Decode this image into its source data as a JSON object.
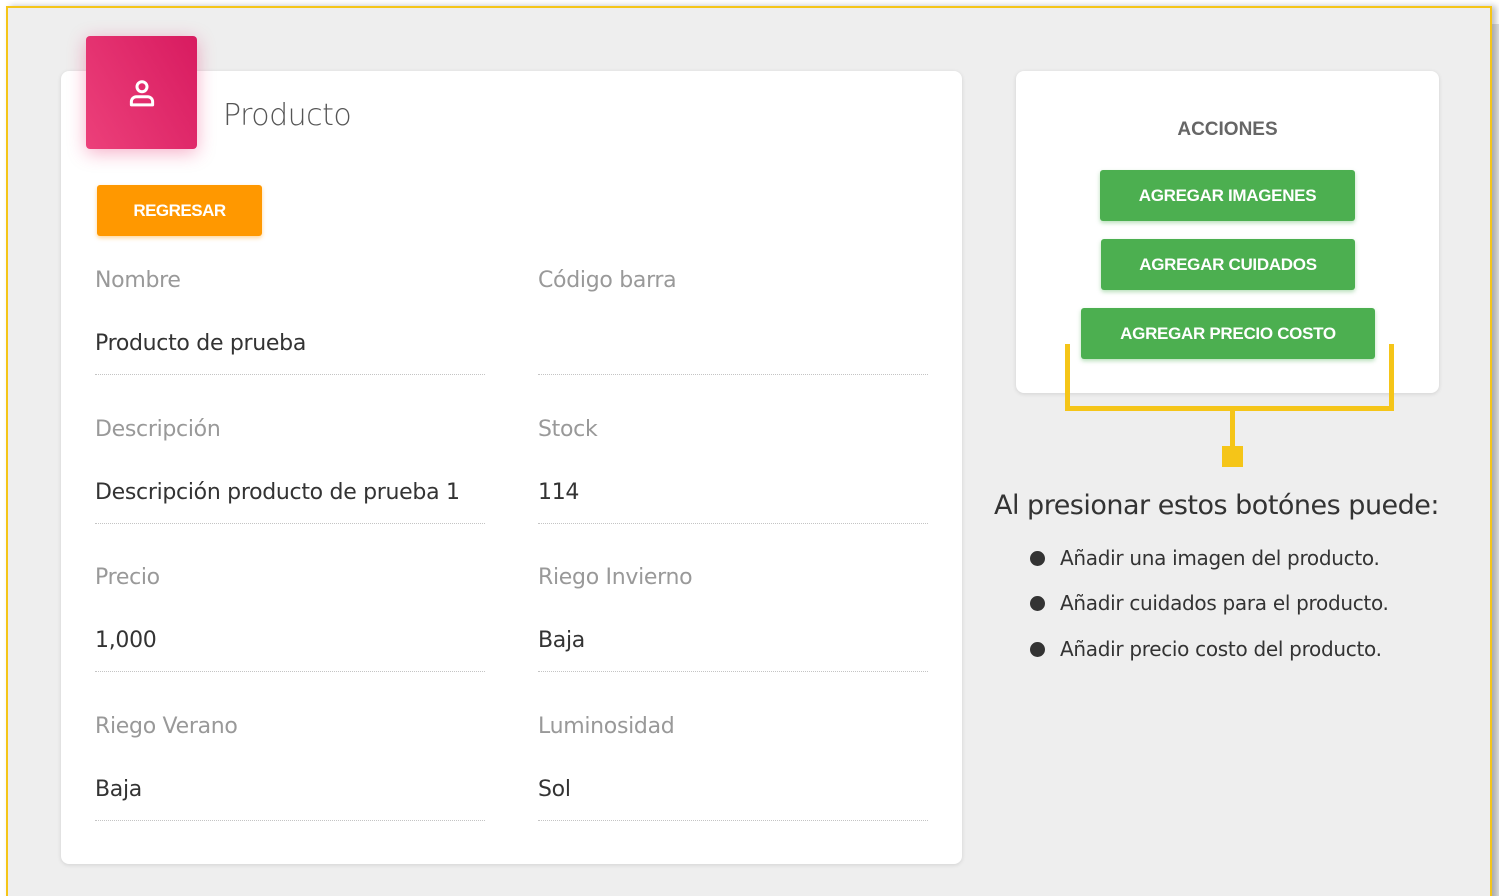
{
  "product_card": {
    "title": "Producto",
    "back_label": "REGRESAR",
    "fields": [
      {
        "label": "Nombre",
        "value": "Producto de prueba"
      },
      {
        "label": "Código barra",
        "value": ""
      },
      {
        "label": "Descripción",
        "value": "Descripción producto de prueba 1"
      },
      {
        "label": "Stock",
        "value": "114"
      },
      {
        "label": "Precio",
        "value": "1,000"
      },
      {
        "label": "Riego Invierno",
        "value": "Baja"
      },
      {
        "label": "Riego Verano",
        "value": "Baja"
      },
      {
        "label": "Luminosidad",
        "value": "Sol"
      }
    ]
  },
  "actions": {
    "title": "ACCIONES",
    "buttons": [
      "AGREGAR IMAGENES",
      "AGREGAR CUIDADOS",
      "AGREGAR PRECIO COSTO"
    ]
  },
  "annotation": {
    "title": "Al presionar estos botónes puede:",
    "items": [
      "Añadir una imagen del producto.",
      "Añadir cuidados para el producto.",
      "Añadir precio costo del producto."
    ]
  },
  "colors": {
    "accent_pink": "#e91e63",
    "back_orange": "#ff9800",
    "action_green": "#4caf50",
    "highlight_yellow": "#f5c518"
  },
  "icons": {
    "header": "person-icon"
  }
}
